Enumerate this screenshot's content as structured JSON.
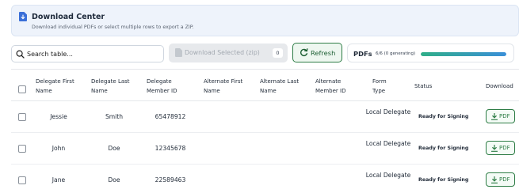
{
  "banner": {
    "title": "Download Center",
    "subtitle": "Download individual PDFs or select multiple rows to export a ZIP.",
    "icon": "document-download-icon"
  },
  "toolbar": {
    "search_placeholder": "Search table...",
    "download_selected_label": "Download Selected (zip)",
    "selected_count": "0",
    "refresh_label": "Refresh",
    "pdfs_label": "PDFs",
    "pdfs_status": "6/6 (0 generating)",
    "pdfs_progress_percent": 100
  },
  "table": {
    "columns": [
      "Delegate First Name",
      "Delegate Last Name",
      "Delegate Member ID",
      "Alternate First Name",
      "Alternate Last Name",
      "Alternate Member ID",
      "Form Type",
      "Status",
      "Download"
    ],
    "rows": [
      {
        "first": "Jessie",
        "last": "Smith",
        "member_id": "65478912",
        "alt_first": "",
        "alt_last": "",
        "alt_id": "",
        "form_type": "Local Delegate",
        "status": "Ready for Signing",
        "download": "PDF"
      },
      {
        "first": "John",
        "last": "Doe",
        "member_id": "12345678",
        "alt_first": "",
        "alt_last": "",
        "alt_id": "",
        "form_type": "Local Delegate",
        "status": "Ready for Signing",
        "download": "PDF"
      },
      {
        "first": "Jane",
        "last": "Doe",
        "member_id": "22589463",
        "alt_first": "",
        "alt_last": "",
        "alt_id": "",
        "form_type": "Local Delegate",
        "status": "Ready for Signing",
        "download": "PDF"
      }
    ]
  },
  "colors": {
    "accent_blue": "#3a6fd8",
    "accent_green": "#2e7d46",
    "banner_bg": "#eef3fb"
  }
}
